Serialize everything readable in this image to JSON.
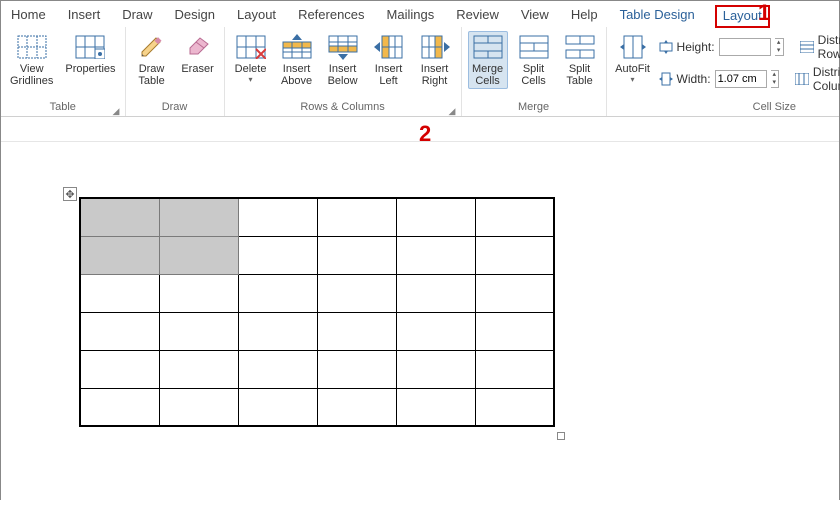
{
  "tabs": {
    "home": "Home",
    "insert": "Insert",
    "draw": "Draw",
    "design": "Design",
    "layout": "Layout",
    "references": "References",
    "mailings": "Mailings",
    "review": "Review",
    "view": "View",
    "help": "Help",
    "table_design": "Table Design",
    "table_layout": "Layout"
  },
  "groups": {
    "table": "Table",
    "draw": "Draw",
    "rows_cols": "Rows & Columns",
    "merge": "Merge",
    "cell_size": "Cell Size"
  },
  "buttons": {
    "view_gridlines": "View\nGridlines",
    "properties": "Properties",
    "draw_table": "Draw\nTable",
    "eraser": "Eraser",
    "delete": "Delete",
    "insert_above": "Insert\nAbove",
    "insert_below": "Insert\nBelow",
    "insert_left": "Insert\nLeft",
    "insert_right": "Insert\nRight",
    "merge_cells": "Merge\nCells",
    "split_cells": "Split\nCells",
    "split_table": "Split\nTable",
    "autofit": "AutoFit"
  },
  "cell_size": {
    "height_label": "Height:",
    "height_value": "",
    "width_label": "Width:",
    "width_value": "1.07 cm",
    "dist_rows": "Distribute Rows",
    "dist_cols": "Distribute Columns"
  },
  "callouts": {
    "one": "1",
    "two": "2"
  },
  "table_grid": {
    "rows": 6,
    "cols": 6,
    "selected_cells": [
      [
        0,
        0
      ],
      [
        0,
        1
      ],
      [
        1,
        0
      ],
      [
        1,
        1
      ]
    ]
  }
}
